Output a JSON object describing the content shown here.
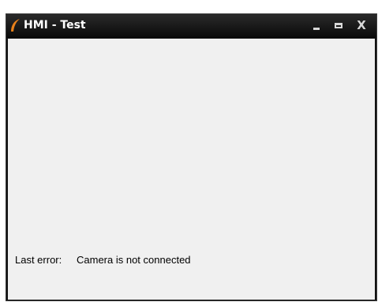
{
  "window": {
    "title": "HMI - Test",
    "app_icon": "flame-swoosh-icon",
    "controls": {
      "minimize_icon": "minimize-icon",
      "maximize_icon": "maximize-icon",
      "close_label": "X"
    }
  },
  "status": {
    "error_label": "Last error:",
    "error_value": "Camera is not connected"
  },
  "colors": {
    "titlebar": "#111111",
    "title_text": "#ffffff",
    "client_background": "#f0f0f0",
    "icon_accent": "#e8801a"
  }
}
